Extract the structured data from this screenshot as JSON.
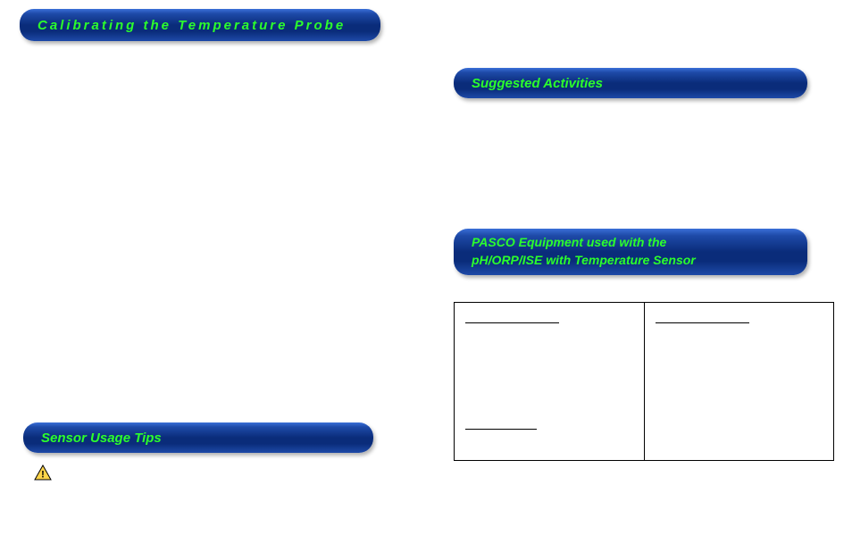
{
  "headers": {
    "calibrating": "Calibrating the Temperature Probe",
    "usage_tips": "Sensor Usage Tips",
    "suggested": "Suggested Activities",
    "equipment_line1": "PASCO Equipment used with the",
    "equipment_line2": "pH/ORP/ISE with Temperature Sensor"
  },
  "icons": {
    "caution": "caution-icon"
  },
  "table": {
    "left_header": "",
    "left_sub": "",
    "right_header": ""
  }
}
